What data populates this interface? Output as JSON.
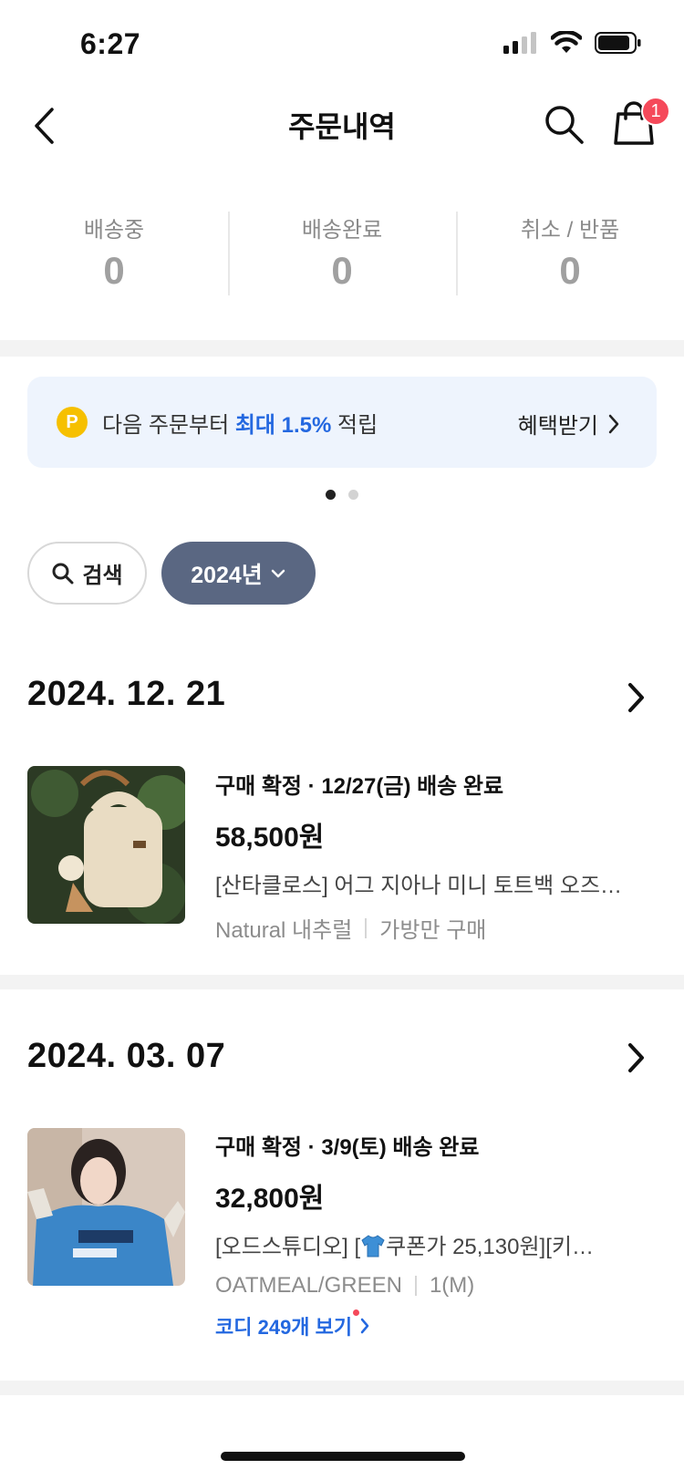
{
  "status_bar": {
    "time": "6:27"
  },
  "nav": {
    "title": "주문내역",
    "cart_count": "1"
  },
  "summary": [
    {
      "label": "배송중",
      "count": "0"
    },
    {
      "label": "배송완료",
      "count": "0"
    },
    {
      "label": "취소 / 반품",
      "count": "0"
    }
  ],
  "banner": {
    "coin": "P",
    "text_before": "다음 주문부터 ",
    "highlight": "최대 1.5%",
    "text_after": " 적립",
    "cta": "혜택받기"
  },
  "carousel": {
    "pages": 2,
    "active": 1
  },
  "filters": {
    "search_label": "검색",
    "year_label": "2024년"
  },
  "orders": [
    {
      "date": "2024. 12. 21",
      "status": "구매 확정 · 12/27(금) 배송 완료",
      "price": "58,500원",
      "name": "[산타클로스] 어그 지아나 미니 토트백 오즈…",
      "option_color": "Natural 내추럴",
      "option_detail": "가방만 구매"
    },
    {
      "date": "2024. 03. 07",
      "status": "구매 확정 · 3/9(토) 배송 완료",
      "price": "32,800원",
      "name_prefix": "[오드스튜디오] [",
      "name_suffix": "쿠폰가 25,130원][키…",
      "option_color": "OATMEAL/GREEN",
      "option_detail": "1(M)",
      "link": "코디 249개 보기"
    }
  ],
  "colors": {
    "accent": "#2468e0",
    "chip_active": "#5a6782",
    "badge": "#f5495a",
    "banner_bg": "#eef4fd"
  }
}
